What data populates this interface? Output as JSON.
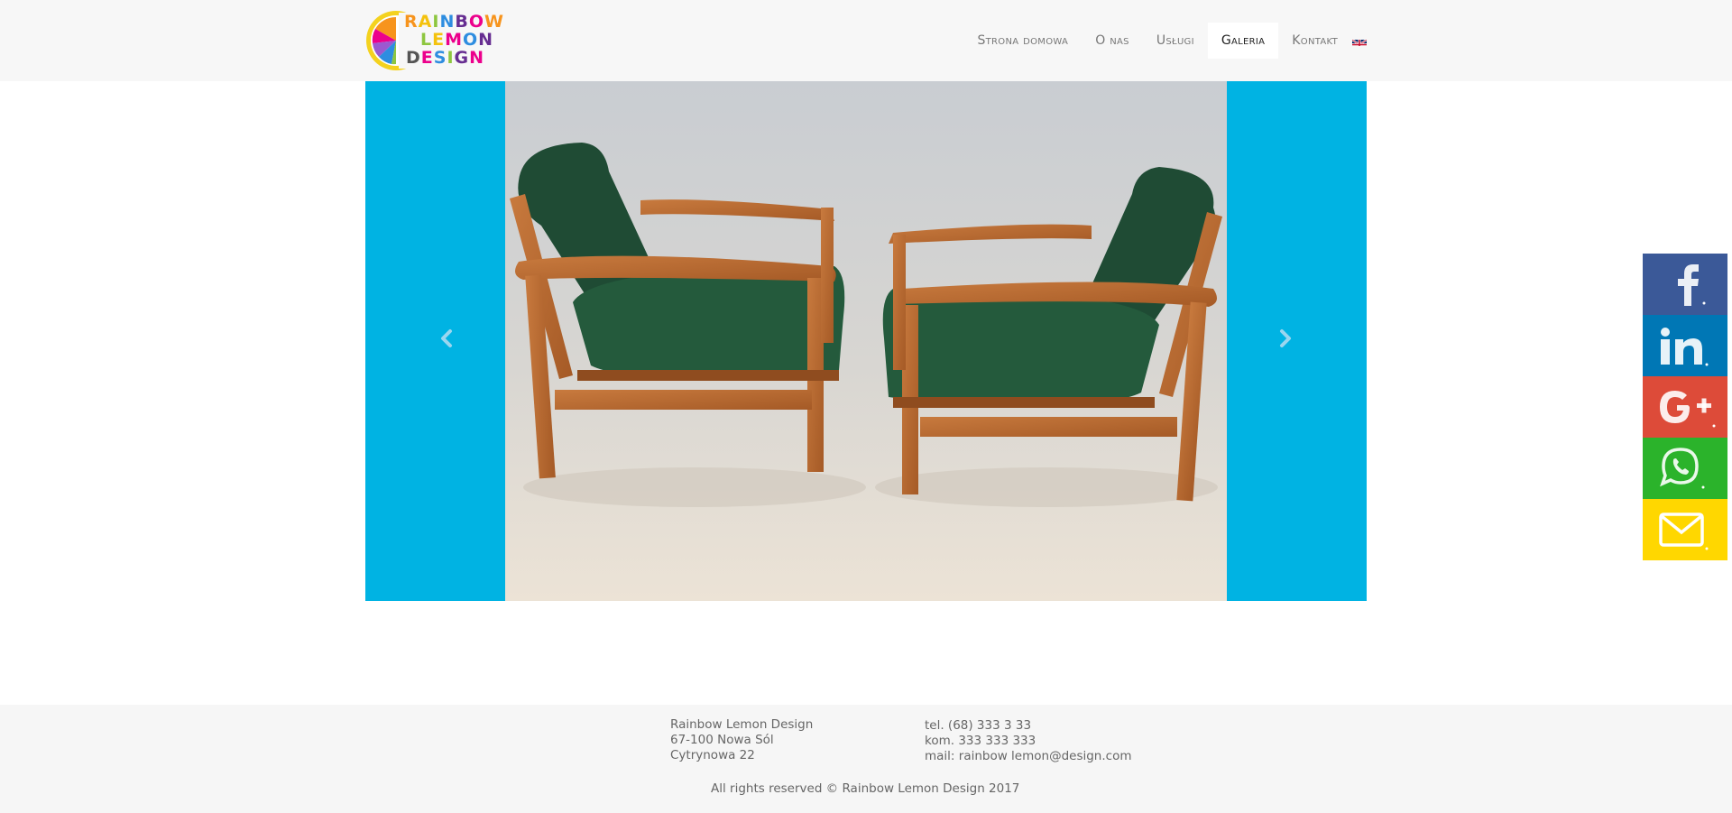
{
  "brand": {
    "logo_line1": "RAINBOW",
    "logo_line2": "LEMON",
    "logo_line3": "DESIGN",
    "logo_colors": [
      "#f7941d",
      "#ec008c",
      "#8dc63f",
      "#00aeef",
      "#662d91"
    ]
  },
  "nav": {
    "items": [
      {
        "label": "Strona domowa"
      },
      {
        "label": "O nas"
      },
      {
        "label": "Usługi"
      },
      {
        "label": "Galeria"
      },
      {
        "label": "Kontakt"
      }
    ],
    "active": "Galeria",
    "language_icon": "uk-flag-icon"
  },
  "slider": {
    "background_color": "#00b3e3",
    "prev_icon": "chevron-left-icon",
    "next_icon": "chevron-right-icon",
    "image": "photo of two wooden armchairs with green upholstery"
  },
  "social": [
    {
      "name": "facebook",
      "icon": "facebook-icon",
      "color": "#3b5998"
    },
    {
      "name": "linkedin",
      "icon": "linkedin-icon",
      "color": "#0077b5"
    },
    {
      "name": "google-plus",
      "icon": "google-plus-icon",
      "color": "#dd4b39"
    },
    {
      "name": "whatsapp",
      "icon": "whatsapp-icon",
      "color": "#2bb32b"
    },
    {
      "name": "email",
      "icon": "mail-icon",
      "color": "#ffd700"
    }
  ],
  "footer": {
    "company": "Rainbow Lemon Design",
    "postal": "67-100 Nowa Sól",
    "street": "Cytrynowa 22",
    "tel": "tel. (68) 333 3 33",
    "mobile": "kom. 333 333 333",
    "mail": "mail: rainbow lemon@design.com",
    "copyright": "All rights reserved © Rainbow Lemon Design 2017"
  }
}
